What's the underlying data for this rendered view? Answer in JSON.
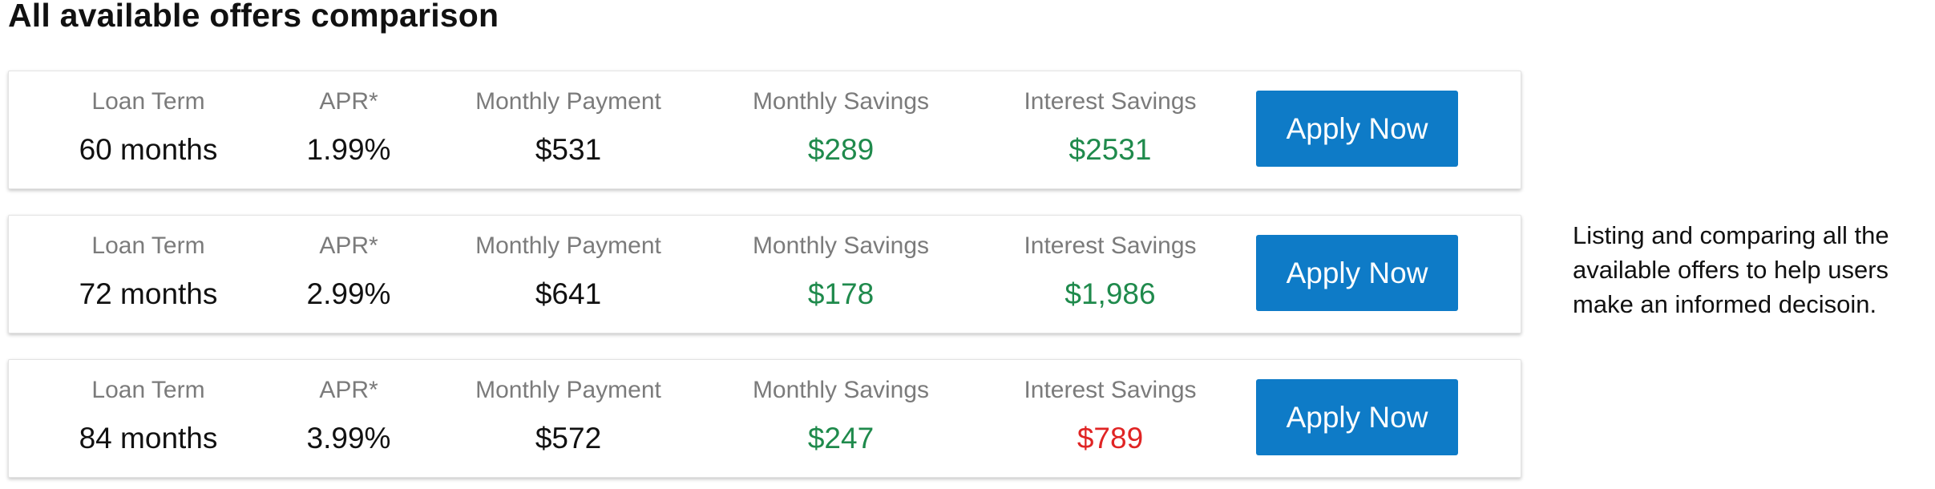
{
  "page": {
    "title": "All available offers comparison"
  },
  "offers": [
    {
      "loan_term_label": "Loan Term",
      "loan_term": "60 months",
      "apr_label": "APR*",
      "apr": "1.99%",
      "monthly_payment_label": "Monthly Payment",
      "monthly_payment": "$531",
      "monthly_savings_label": "Monthly Savings",
      "monthly_savings": "$289",
      "interest_savings_label": "Interest Savings",
      "interest_savings": "$2531",
      "interest_savings_status": "positive",
      "apply_label": "Apply Now"
    },
    {
      "loan_term_label": "Loan Term",
      "loan_term": "72 months",
      "apr_label": "APR*",
      "apr": "2.99%",
      "monthly_payment_label": "Monthly Payment",
      "monthly_payment": "$641",
      "monthly_savings_label": "Monthly Savings",
      "monthly_savings": "$178",
      "interest_savings_label": "Interest Savings",
      "interest_savings": "$1,986",
      "interest_savings_status": "positive",
      "apply_label": "Apply Now"
    },
    {
      "loan_term_label": "Loan Term",
      "loan_term": "84 months",
      "apr_label": "APR*",
      "apr": "3.99%",
      "monthly_payment_label": "Monthly Payment",
      "monthly_payment": "$572",
      "monthly_savings_label": "Monthly Savings",
      "monthly_savings": "$247",
      "interest_savings_label": "Interest Savings",
      "interest_savings": "$789",
      "interest_savings_status": "negative",
      "apply_label": "Apply Now"
    }
  ],
  "side_note": {
    "lines": [
      "Listing and comparing all the",
      "available offers to help users",
      "make an informed decisoin."
    ]
  },
  "colors": {
    "button_blue": "#0e7bc7",
    "savings_green": "#1f8a4c",
    "loss_red": "#e02424",
    "label_gray": "#7b7b7b"
  }
}
